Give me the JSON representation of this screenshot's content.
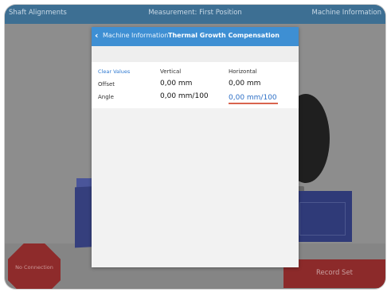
{
  "appbar": {
    "left": "Shaft Alignments",
    "center": "Measurement: First Position",
    "right": "Machine Information"
  },
  "background": {
    "no_connection": "No Connection",
    "record_set": "Record Set"
  },
  "dialog": {
    "back_label": "Machine Information",
    "title": "Thermal Growth Compensation",
    "clear_values": "Clear Values",
    "columns": {
      "vertical": "Vertical",
      "horizontal": "Horizontal"
    },
    "rows": {
      "offset": {
        "label": "Offset",
        "vertical": "0,00 mm",
        "horizontal": "0,00 mm"
      },
      "angle": {
        "label": "Angle",
        "vertical": "0,00 mm/100",
        "horizontal": "0,00 mm/100"
      }
    }
  },
  "colors": {
    "header_blue": "#3e8fd3",
    "appbar_dim": "#3d6f93",
    "link_blue": "#2d78d0",
    "input_underline": "#d9644e",
    "alert_red": "#8c2a2a"
  }
}
